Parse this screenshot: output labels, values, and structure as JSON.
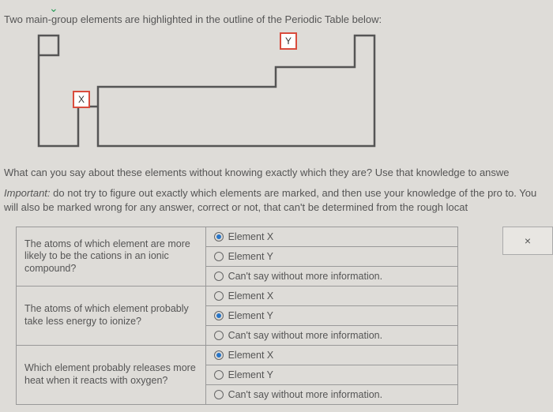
{
  "intro": "Two main-group elements are highlighted in the outline of the Periodic Table below:",
  "elements": {
    "x_label": "X",
    "y_label": "Y"
  },
  "question_text": "What can you say about these elements without knowing exactly which they are? Use that knowledge to answe",
  "important_label": "Important:",
  "important_text": " do not try to figure out exactly which elements are marked, and then use your knowledge of the pro to. You will also be marked wrong for any answer, correct or not, that can't be determined from the rough locat",
  "questions": [
    {
      "prompt": "The atoms of which element are more likely to be the cations in an ionic compound?",
      "options": [
        "Element X",
        "Element Y",
        "Can't say without more information."
      ],
      "selected": 0
    },
    {
      "prompt": "The atoms of which element probably take less energy to ionize?",
      "options": [
        "Element X",
        "Element Y",
        "Can't say without more information."
      ],
      "selected": 1
    },
    {
      "prompt": "Which element probably releases more heat when it reacts with oxygen?",
      "options": [
        "Element X",
        "Element Y",
        "Can't say without more information."
      ],
      "selected": 0
    }
  ],
  "close_label": "×"
}
